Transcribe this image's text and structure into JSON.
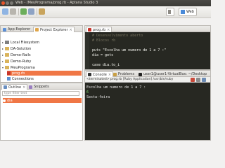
{
  "window": {
    "title": "Web - /MeuPrograma/prog.rb - Aptana Studio 3"
  },
  "toolbar": {
    "perspective_label": "Web"
  },
  "left_panel": {
    "tabs": [
      {
        "label": "App Explorer"
      },
      {
        "label": "Project Explorer"
      }
    ],
    "tree": [
      {
        "label": "Local Filesystem",
        "level": 0,
        "expanded": false
      },
      {
        "label": "DA-Solution",
        "level": 0,
        "expanded": false
      },
      {
        "label": "Demo-Rails",
        "level": 0,
        "expanded": false
      },
      {
        "label": "Demo-Ruby",
        "level": 0,
        "expanded": false
      },
      {
        "label": "MeuPrograma",
        "level": 0,
        "expanded": true
      },
      {
        "label": "prog.rb",
        "level": 1,
        "selected": true
      },
      {
        "label": "Connections",
        "level": 1
      }
    ]
  },
  "outline_panel": {
    "tabs": [
      {
        "label": "Outline"
      },
      {
        "label": "Snippets"
      }
    ],
    "filter_placeholder": "type filter text",
    "items": [
      {
        "label": "dia"
      }
    ]
  },
  "editor": {
    "tab_label": "prog.rb",
    "lines": [
      {
        "text": "# Desenvolvimento aberto",
        "color": "#75715e"
      },
      {
        "text": "# Blocos rb",
        "color": "#75715e"
      },
      {
        "text": "",
        "color": "#f8f8f2"
      },
      {
        "text": "puts \"Escolha um numero de 1 a 7 :\"",
        "color": "#f8f8f2"
      },
      {
        "text": "dia = gets",
        "color": "#f8f8f2"
      },
      {
        "text": "",
        "color": "#f8f8f2"
      },
      {
        "text": "case dia.to_i",
        "color": "#f8f8f2"
      }
    ]
  },
  "console": {
    "tabs": [
      {
        "label": "Console"
      },
      {
        "label": "Problems"
      },
      {
        "label": "user1@user1-VirtualBox: ~/Desktop"
      }
    ],
    "path": "<terminated> prog.rb [Ruby Application] /usr/bin/ruby",
    "lines": [
      {
        "text": "Escolha um numero de 1 a 7 :"
      },
      {
        "text": "6"
      },
      {
        "text": "Sexta-feira"
      }
    ]
  },
  "colors": {
    "titlebar": "#3c3b37",
    "editor_bg": "#272822",
    "close_button": "#e9542a"
  }
}
